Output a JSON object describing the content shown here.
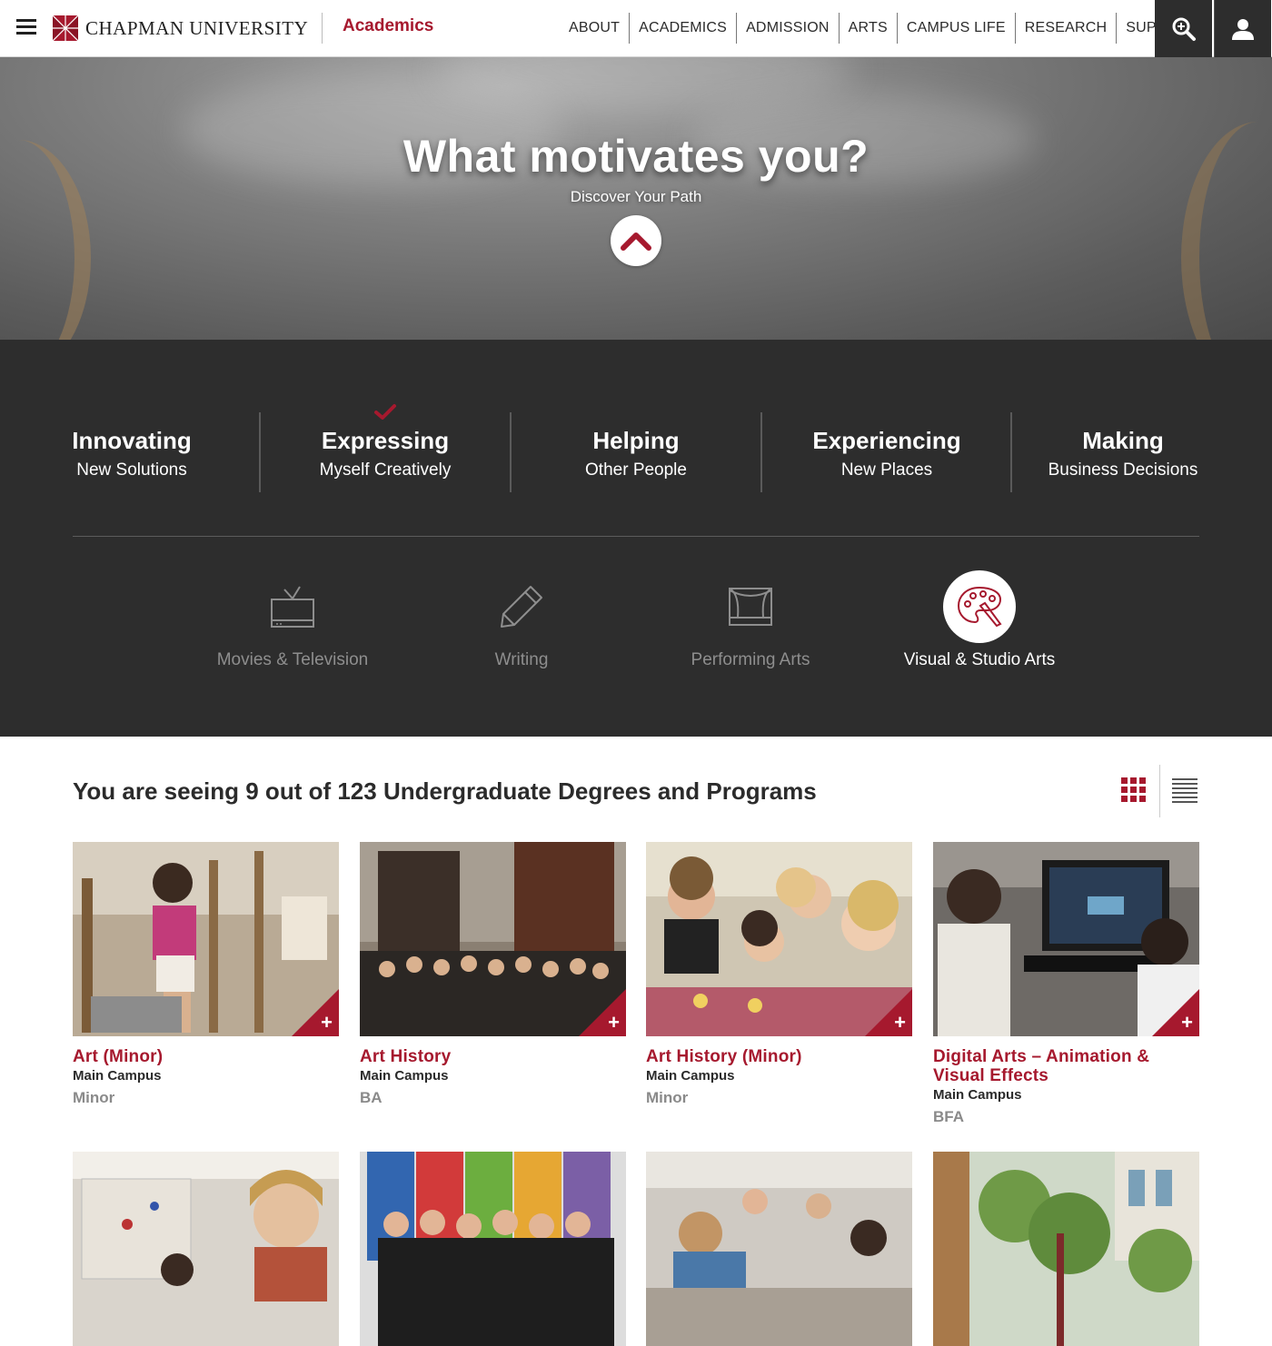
{
  "header": {
    "logo_text": "CHAPMAN UNIVERSITY",
    "section_title": "Academics",
    "nav": [
      "ABOUT",
      "ACADEMICS",
      "ADMISSION",
      "ARTS",
      "CAMPUS LIFE",
      "RESEARCH",
      "SUPPORT"
    ],
    "search_icon": "search-icon",
    "user_icon": "user-icon"
  },
  "hero": {
    "title": "What motivates you?",
    "subtitle": "Discover Your Path",
    "toggle_icon": "chevron-up-icon"
  },
  "motivations": [
    {
      "title": "Innovating",
      "subtitle": "New Solutions",
      "selected": false
    },
    {
      "title": "Expressing",
      "subtitle": "Myself Creatively",
      "selected": true
    },
    {
      "title": "Helping",
      "subtitle": "Other People",
      "selected": false
    },
    {
      "title": "Experiencing",
      "subtitle": "New Places",
      "selected": false
    },
    {
      "title": "Making",
      "subtitle": "Business Decisions",
      "selected": false
    }
  ],
  "categories": [
    {
      "label": "Movies & Television",
      "icon": "tv-icon",
      "active": false
    },
    {
      "label": "Writing",
      "icon": "pencil-icon",
      "active": false
    },
    {
      "label": "Performing Arts",
      "icon": "stage-icon",
      "active": false
    },
    {
      "label": "Visual & Studio Arts",
      "icon": "palette-icon",
      "active": true
    }
  ],
  "results": {
    "heading": "You are seeing 9 out of 123 Undergraduate Degrees and Programs",
    "grid_view_icon": "grid-view-icon",
    "list_view_icon": "list-view-icon"
  },
  "programs": [
    {
      "title": "Art (Minor)",
      "campus": "Main Campus",
      "degree": "Minor"
    },
    {
      "title": "Art History",
      "campus": "Main Campus",
      "degree": "BA"
    },
    {
      "title": "Art History (Minor)",
      "campus": "Main Campus",
      "degree": "Minor"
    },
    {
      "title": "Digital Arts – Animation & Visual Effects",
      "campus": "Main Campus",
      "degree": "BFA"
    }
  ],
  "colors": {
    "brand_red": "#a6192e",
    "dark_panel": "#2d2d2d"
  }
}
